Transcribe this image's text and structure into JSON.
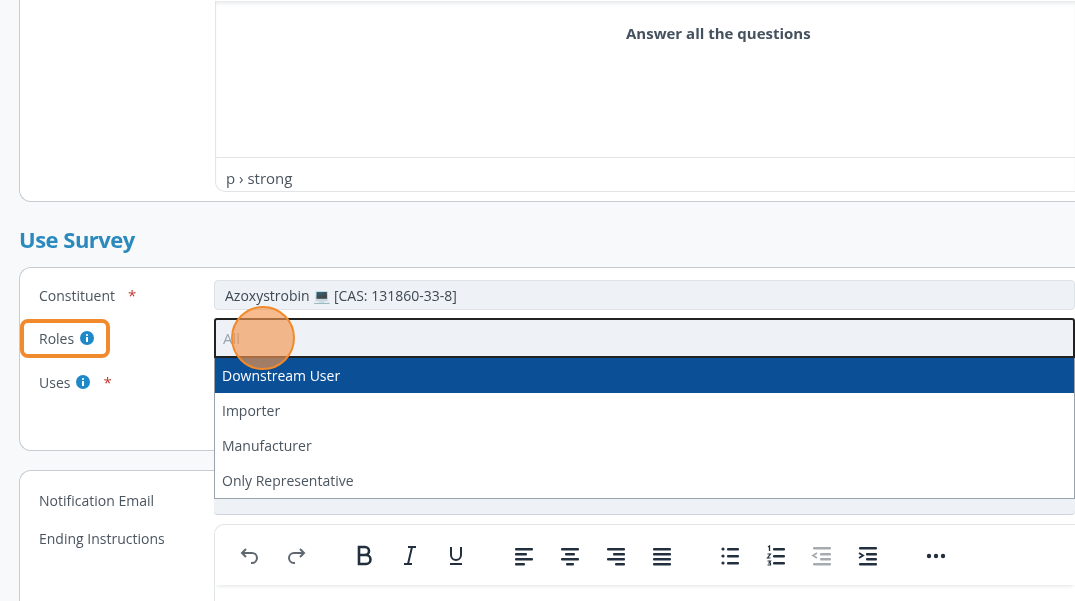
{
  "intro_editor": {
    "content": "Answer all the questions",
    "path": "p › strong"
  },
  "section_title": "Use Survey",
  "survey_fields": [
    {
      "label": "Constituent",
      "required_mark": "*",
      "info": false,
      "kind": "readonly",
      "value": "Azoxystrobin 💻 [CAS: 131860-33-8]"
    },
    {
      "label": "Roles",
      "info": true,
      "highlighted": true,
      "kind": "select",
      "placeholder": "All",
      "expanded": true,
      "options": [
        {
          "label": "Downstream User",
          "selected": true
        },
        {
          "label": "Importer",
          "selected": false
        },
        {
          "label": "Manufacturer",
          "selected": false
        },
        {
          "label": "Only Representative",
          "selected": false
        }
      ]
    },
    {
      "label": "Uses",
      "required_mark": "*",
      "info": true,
      "kind": "hidden"
    }
  ],
  "notification_email": {
    "label": "Notification Email"
  },
  "ending_instructions": {
    "label": "Ending Instructions",
    "toolbar": [
      {
        "kind": "undo",
        "disabled": false
      },
      {
        "kind": "redo",
        "disabled": false
      },
      {
        "kind": "sep"
      },
      {
        "kind": "bold",
        "disabled": false
      },
      {
        "kind": "italic",
        "disabled": false
      },
      {
        "kind": "underline",
        "disabled": false
      },
      {
        "kind": "sep"
      },
      {
        "kind": "align-left",
        "disabled": false
      },
      {
        "kind": "align-center",
        "disabled": false
      },
      {
        "kind": "align-right",
        "disabled": false
      },
      {
        "kind": "justify",
        "disabled": false
      },
      {
        "kind": "sep"
      },
      {
        "kind": "bullets",
        "disabled": false
      },
      {
        "kind": "numbers",
        "disabled": false
      },
      {
        "kind": "outdent",
        "disabled": true
      },
      {
        "kind": "indent",
        "disabled": false
      },
      {
        "kind": "sep"
      },
      {
        "kind": "more",
        "disabled": false
      }
    ]
  }
}
